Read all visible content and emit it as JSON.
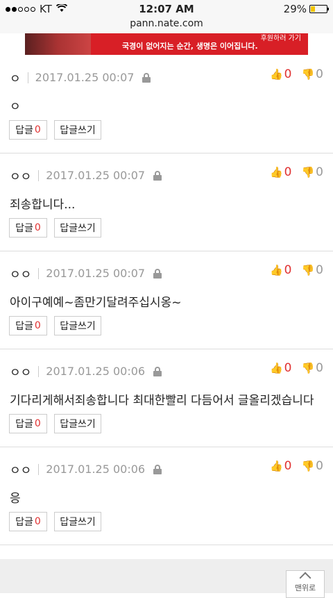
{
  "status": {
    "carrier": "KT",
    "time": "12:07 AM",
    "battery": "29%"
  },
  "browser": {
    "url": "pann.nate.com"
  },
  "banner": {
    "text": "국경이 없어지는 순간, 생명은 이어집니다.",
    "button": "후원하러 가기"
  },
  "comments": [
    {
      "author": "ㅇ",
      "date": "2017.01.25 00:07",
      "up": "0",
      "down": "0",
      "text": "ㅇ",
      "reply_label": "답글",
      "reply_count": "0",
      "write_label": "답글쓰기"
    },
    {
      "author": "ㅇㅇ",
      "date": "2017.01.25 00:07",
      "up": "0",
      "down": "0",
      "text": "죄송합니다...",
      "reply_label": "답글",
      "reply_count": "0",
      "write_label": "답글쓰기"
    },
    {
      "author": "ㅇㅇ",
      "date": "2017.01.25 00:07",
      "up": "0",
      "down": "0",
      "text": "아이구예예~좀만기달려주십시옹~",
      "reply_label": "답글",
      "reply_count": "0",
      "write_label": "답글쓰기"
    },
    {
      "author": "ㅇㅇ",
      "date": "2017.01.25 00:06",
      "up": "0",
      "down": "0",
      "text": "기다리게해서죄송합니다 최대한빨리 다듬어서 글올리겠습니다",
      "reply_label": "답글",
      "reply_count": "0",
      "write_label": "답글쓰기"
    },
    {
      "author": "ㅇㅇ",
      "date": "2017.01.25 00:06",
      "up": "0",
      "down": "0",
      "text": "응",
      "reply_label": "답글",
      "reply_count": "0",
      "write_label": "답글쓰기"
    }
  ],
  "footer": {
    "top_button": "맨위로"
  },
  "colors": {
    "accent": "#e03131",
    "banner": "#d81f26"
  }
}
